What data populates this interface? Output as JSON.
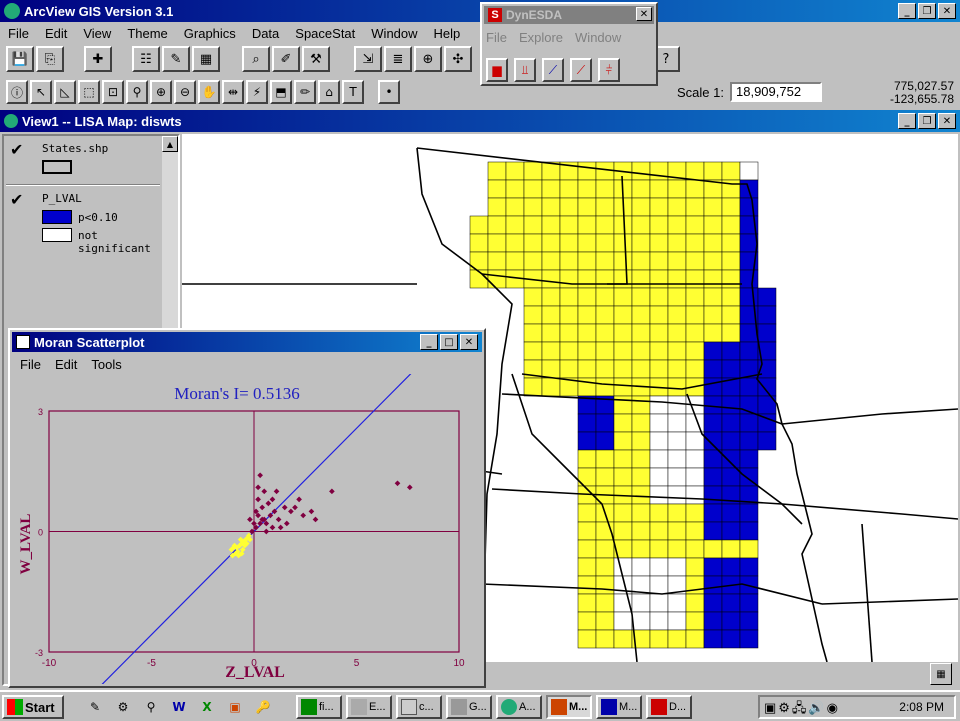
{
  "app": {
    "title": "ArcView GIS Version 3.1",
    "menu": [
      "File",
      "Edit",
      "View",
      "Theme",
      "Graphics",
      "Data",
      "SpaceStat",
      "Window",
      "Help"
    ]
  },
  "scale": {
    "label": "Scale 1:",
    "value": "18,909,752",
    "coord_x": "775,027.57",
    "coord_y": "-123,655.78"
  },
  "dynesda": {
    "title": "DynESDA",
    "menu": [
      "File",
      "Explore",
      "Window"
    ]
  },
  "view": {
    "title": "View1 -- LISA Map: diswts",
    "themes": [
      {
        "name": "States.shp",
        "checked": true
      },
      {
        "name": "P_LVAL",
        "checked": true,
        "classes": [
          {
            "label": "p<0.10",
            "color": "#0000cc"
          },
          {
            "label": "not significant",
            "color": "#ffffff"
          }
        ]
      }
    ]
  },
  "map": {
    "colors": {
      "cluster": "#ffff33",
      "significant": "#0000cc",
      "none": "#ffffff",
      "outline": "#000000"
    }
  },
  "scatter": {
    "title": "Moran Scatterplot",
    "menu": [
      "File",
      "Edit",
      "Tools"
    ],
    "statistic": "Moran's I= 0.5136"
  },
  "chart_data": {
    "type": "scatter",
    "title": "Moran's I= 0.5136",
    "xlabel": "Z_LVAL",
    "ylabel": "W_LVAL",
    "xlim": [
      -10,
      10
    ],
    "ylim": [
      -3,
      3
    ],
    "x_ticks": [
      "-10",
      "-5",
      "0",
      "5",
      "10"
    ],
    "y_ticks": [
      "3",
      "0",
      "-3"
    ],
    "regression": {
      "slope": 0.5136,
      "intercept": 0
    },
    "series": [
      {
        "color": "#ffff33",
        "points": [
          [
            -1.0,
            -0.4
          ],
          [
            -0.8,
            -0.5
          ],
          [
            -0.6,
            -0.3
          ],
          [
            -0.9,
            -0.55
          ],
          [
            -0.7,
            -0.35
          ],
          [
            -0.5,
            -0.25
          ],
          [
            -1.1,
            -0.45
          ],
          [
            -0.4,
            -0.2
          ],
          [
            -0.3,
            -0.15
          ],
          [
            -0.75,
            -0.6
          ],
          [
            -0.85,
            -0.4
          ],
          [
            -0.55,
            -0.45
          ],
          [
            -0.65,
            -0.2
          ],
          [
            -0.95,
            -0.35
          ],
          [
            -0.45,
            -0.35
          ],
          [
            -0.35,
            -0.3
          ],
          [
            -0.25,
            -0.1
          ],
          [
            -1.05,
            -0.6
          ],
          [
            -0.6,
            -0.55
          ],
          [
            -0.2,
            -0.2
          ]
        ]
      },
      {
        "color": "#800040",
        "points": [
          [
            0.1,
            0.1
          ],
          [
            0.3,
            0.2
          ],
          [
            0.5,
            0.3
          ],
          [
            0.2,
            0.4
          ],
          [
            0.6,
            0.2
          ],
          [
            0.8,
            0.4
          ],
          [
            1.0,
            0.5
          ],
          [
            0.4,
            0.6
          ],
          [
            0.7,
            0.7
          ],
          [
            1.2,
            0.3
          ],
          [
            1.5,
            0.6
          ],
          [
            0.9,
            0.8
          ],
          [
            0.2,
            0.8
          ],
          [
            0.5,
            1.0
          ],
          [
            1.1,
            1.0
          ],
          [
            1.8,
            0.5
          ],
          [
            2.0,
            0.6
          ],
          [
            2.4,
            0.4
          ],
          [
            2.8,
            0.5
          ],
          [
            3.0,
            0.3
          ],
          [
            0.3,
            1.4
          ],
          [
            0.2,
            1.1
          ],
          [
            0.1,
            0.5
          ],
          [
            0.0,
            0.2
          ],
          [
            -0.2,
            0.3
          ],
          [
            1.3,
            0.1
          ],
          [
            0.6,
            0.0
          ],
          [
            3.8,
            1.0
          ],
          [
            7.0,
            1.2
          ],
          [
            7.6,
            1.1
          ],
          [
            1.6,
            0.2
          ],
          [
            0.9,
            0.1
          ],
          [
            2.2,
            0.8
          ],
          [
            -0.1,
            0.0
          ],
          [
            0.4,
            0.3
          ]
        ]
      }
    ]
  },
  "taskbar": {
    "start": "Start",
    "tasks": [
      "fi...",
      "E...",
      "c...",
      "G...",
      "A...",
      "M...",
      "M...",
      "D..."
    ],
    "time": "2:08 PM"
  }
}
